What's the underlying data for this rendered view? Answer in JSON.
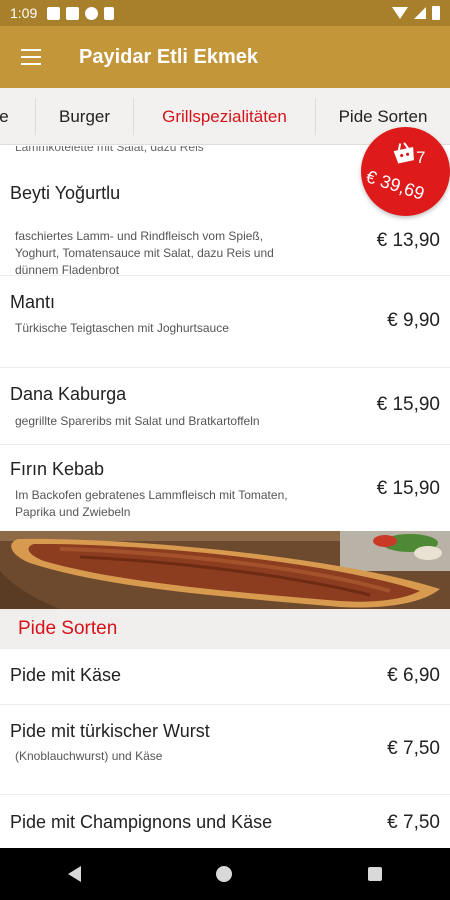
{
  "status_bar": {
    "time": "1:09",
    "icons": [
      "square-notification-icon",
      "square-notification-icon",
      "app-notification-icon",
      "sd-card-icon"
    ],
    "right_icons": [
      "wifi-icon",
      "signal-icon",
      "battery-icon"
    ]
  },
  "app_bar": {
    "title": "Payidar Etli Ekmek",
    "menu_icon": "hamburger-menu-icon"
  },
  "tabs": [
    {
      "label": "e",
      "active": false
    },
    {
      "label": "Burger",
      "active": false
    },
    {
      "label": "Grillspezialitäten",
      "active": true
    },
    {
      "label": "Pide Sorten",
      "active": false
    }
  ],
  "colors": {
    "status_bar": "#a87f2a",
    "app_bar": "#c4963a",
    "accent": "#d6131b",
    "cart_badge": "#de1a1a"
  },
  "partial_text": "Lammkotelette mit Salat, dazu Reis",
  "grill_items": [
    {
      "name": "Beyti Yoğurtlu",
      "description": "faschiertes Lamm- und Rindfleisch vom Spieß, Yoghurt, Tomatensauce mit Salat, dazu Reis und dünnem Fladenbrot",
      "price": "€ 13,90"
    },
    {
      "name": "Mantı",
      "description": "Türkische Teigtaschen mit Joghurtsauce",
      "price": "€ 9,90"
    },
    {
      "name": "Dana Kaburga",
      "description": "gegrillte Spareribs mit Salat und Bratkartoffeln",
      "price": "€ 15,90"
    },
    {
      "name": "Fırın Kebab",
      "description": "Im Backofen gebratenes Lammfleisch mit Tomaten, Paprika und Zwiebeln",
      "price": "€ 15,90"
    }
  ],
  "section": {
    "title": "Pide Sorten"
  },
  "pide_items": [
    {
      "name": "Pide mit Käse",
      "description": "",
      "price": "€ 6,90"
    },
    {
      "name": "Pide mit türkischer Wurst",
      "description": "(Knoblauchwurst) und Käse",
      "price": "€ 7,50"
    },
    {
      "name": "Pide mit Champignons und Käse",
      "description": "",
      "price": "€ 7,50"
    }
  ],
  "cart": {
    "count": "7",
    "total": "€ 39,69",
    "icon": "shopping-bag-icon"
  },
  "nav_bar": {
    "icons": [
      "back-icon",
      "home-icon",
      "recents-icon"
    ]
  }
}
